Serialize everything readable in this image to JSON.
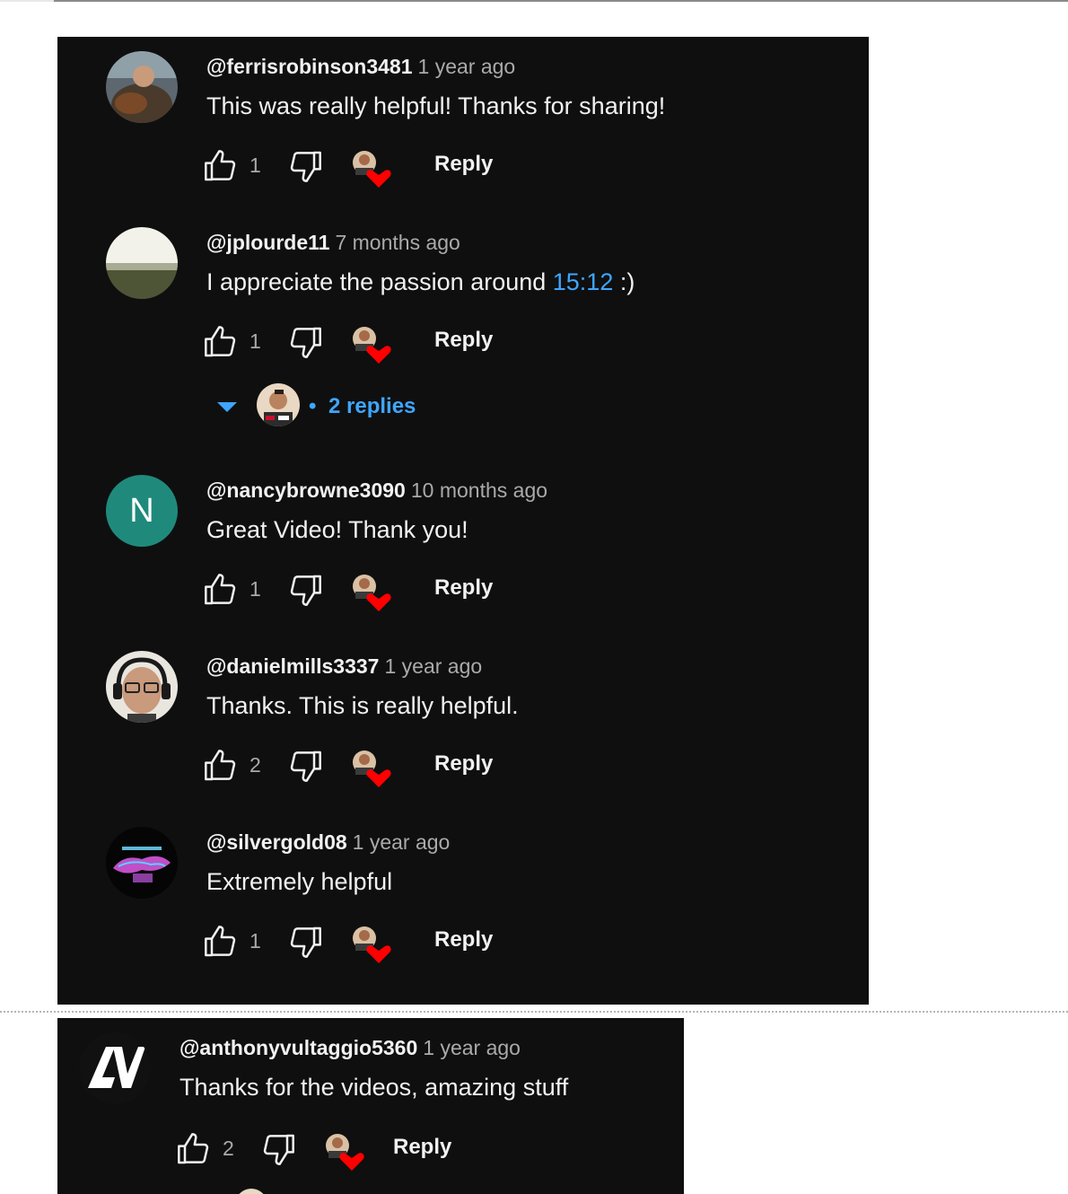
{
  "comments": [
    {
      "author": "@ferrisrobinson3481",
      "time": "1 year ago",
      "text": "This was really helpful! Thanks for sharing!",
      "likes": "1",
      "reply_label": "Reply",
      "avatar": "photo-man-with-dog"
    },
    {
      "author": "@jplourde11",
      "time": "7 months ago",
      "text_before": "I appreciate the passion around ",
      "timestamp": "15:12",
      "text_after": " :)",
      "likes": "1",
      "reply_label": "Reply",
      "avatar": "photo-landscape",
      "replies": {
        "label": "2 replies",
        "bullet": "•"
      }
    },
    {
      "author": "@nancybrowne3090",
      "time": "10 months ago",
      "text": "Great Video! Thank you!",
      "likes": "1",
      "reply_label": "Reply",
      "avatar_letter": "N",
      "avatar_color": "#1f8a7b"
    },
    {
      "author": "@danielmills3337",
      "time": "1 year ago",
      "text": "Thanks. This is really helpful.",
      "likes": "2",
      "reply_label": "Reply",
      "avatar": "photo-man-with-headset"
    },
    {
      "author": "@silvergold08",
      "time": "1 year ago",
      "text": "Extremely helpful",
      "likes": "1",
      "reply_label": "Reply",
      "avatar": "neon-logo"
    },
    {
      "author": "@anthonyvultaggio5360",
      "time": "1 year ago",
      "text": "Thanks for the videos, amazing stuff",
      "likes": "2",
      "reply_label": "Reply",
      "avatar": "av-logo"
    }
  ],
  "colors": {
    "background": "#0f0f0f",
    "text": "#f1f1f1",
    "muted": "#aaaaaa",
    "link": "#3ea6ff",
    "heart": "#ff0000"
  }
}
